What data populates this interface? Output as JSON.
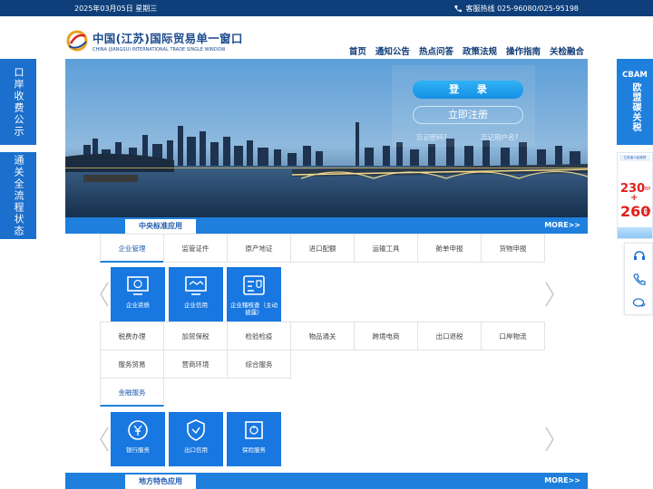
{
  "topbar": {
    "date": "2025年03月05日 星期三",
    "hotline": "客服热线 025-96080/025-95198"
  },
  "header": {
    "logo_cn": "中国(江苏)国际贸易单一窗口",
    "logo_en": "CHINA (JIANGSU) INTERNATIONAL TRADE SINGLE WINDOW",
    "nav": [
      "首页",
      "通知公告",
      "热点问答",
      "政策法规",
      "操作指南",
      "关检融合"
    ]
  },
  "login": {
    "login_label": "登 录",
    "register_label": "立即注册",
    "forgot_password": "忘记密码?",
    "forgot_username": "忘记用户名?"
  },
  "central": {
    "tab": "中央标准应用",
    "more": "MORE>>",
    "row1": [
      "企业管理",
      "监管证件",
      "原产地证",
      "进口配额",
      "运输工具",
      "舱单申报",
      "货物申报"
    ],
    "tiles1": [
      "企业资质",
      "企业信用",
      "企业稽核查（主动披露）"
    ],
    "row2": [
      "税费办理",
      "加贸保税",
      "检验检疫",
      "物品通关",
      "跨境电商",
      "出口退税",
      "口岸物流"
    ],
    "row3": [
      "服务贸易",
      "营商环境",
      "综合服务"
    ],
    "row4": [
      "金融服务"
    ],
    "tiles2": [
      "银行服务",
      "出口信用",
      "保险服务"
    ]
  },
  "local": {
    "tab": "地方特色应用",
    "more": "MORE>>"
  },
  "side_left": [
    "口岸收费公示",
    "通关全流程状态"
  ],
  "side_right": {
    "cbam_title": "CBAM",
    "cbam_sub": "欧盟碳关税",
    "bp_header": "江苏省人民政府",
    "bp_value1": "230",
    "bp_value2": "260",
    "bp_unit": "BP"
  },
  "colors": {
    "primary": "#1f7fdc",
    "topbar": "#0e3f7a",
    "tile": "#1877e0"
  }
}
